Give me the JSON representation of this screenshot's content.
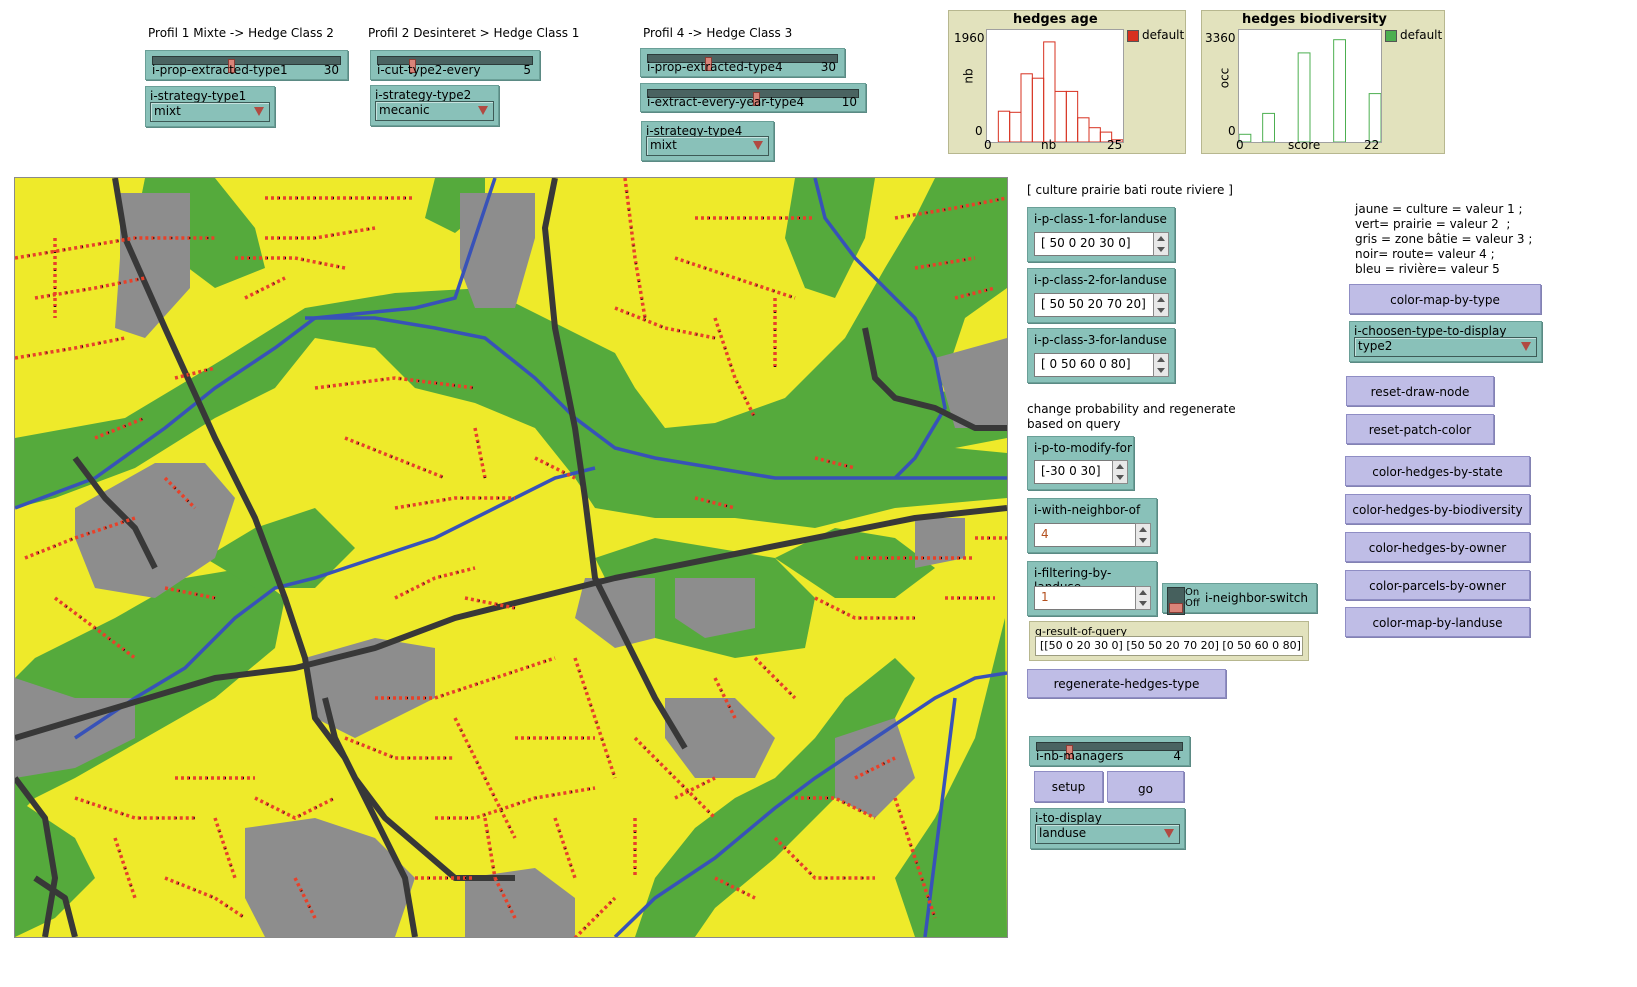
{
  "profiles": {
    "p1_title": "Profil 1 Mixte -> Hedge Class 2",
    "p2_title": "Profil 2 Desinteret > Hedge Class 1",
    "p4_title": "Profil 4 -> Hedge Class 3"
  },
  "sliders": {
    "prop1": {
      "label": "i-prop-extracted-type1",
      "value": "30",
      "fraction": 0.4
    },
    "cut2": {
      "label": "i-cut-type2-every",
      "value": "5",
      "fraction": 0.2
    },
    "prop4": {
      "label": "i-prop-extracted-type4",
      "value": "30",
      "fraction": 0.3
    },
    "extract4": {
      "label": "i-extract-every-year-type4",
      "value": "10",
      "fraction": 0.5
    },
    "managers": {
      "label": "i-nb-managers",
      "value": "4",
      "fraction": 0.2
    }
  },
  "choosers": {
    "strategy1": {
      "label": "i-strategy-type1",
      "value": "mixt"
    },
    "strategy2": {
      "label": "i-strategy-type2",
      "value": "mecanic"
    },
    "strategy4": {
      "label": "i-strategy-type4",
      "value": "mixt"
    },
    "display_type": {
      "label": "i-choosen-type-to-display",
      "value": "type2"
    },
    "to_display": {
      "label": "i-to-display",
      "value": "landuse"
    }
  },
  "plots": {
    "age": {
      "title": "hedges age",
      "ylabel": "nb",
      "xlabel": "nb",
      "ymin": "0",
      "ymax": "1960",
      "xmin": "0",
      "xmax": "25",
      "legend": "default",
      "color": "#d7301f"
    },
    "biodiv": {
      "title": "hedges biodiversity",
      "ylabel": "occ",
      "xlabel": "score",
      "ymin": "0",
      "ymax": "3360",
      "xmin": "0",
      "xmax": "22",
      "legend": "default",
      "color": "#4caf50"
    }
  },
  "landuse_header": "[ culture prairie bati route riviere ]",
  "inputs": {
    "class1": {
      "label": "i-p-class-1-for-landuse",
      "value": "[ 50 0 20 30 0]"
    },
    "class2": {
      "label": "i-p-class-2-for-landuse",
      "value": "[ 50 50 20 70 20]"
    },
    "class3": {
      "label": "i-p-class-3-for-landuse",
      "value": "[ 0 50 60 0 80]"
    },
    "modify": {
      "label": "i-p-to-modify-for",
      "value": "[-30 0 30]"
    },
    "neighbor": {
      "label": "i-with-neighbor-of",
      "value": "4"
    },
    "filtering": {
      "label": "i-filtering-by-landuse",
      "value": "1"
    }
  },
  "query_note": "change probability and regenerate\nbased on query",
  "switch": {
    "label": "i-neighbor-switch",
    "on": "On",
    "off": "Off"
  },
  "monitor": {
    "label": "g-result-of-query",
    "value": "[[50 0 20 30 0] [50 50 20 70 20] [0 50 60 0 80]]"
  },
  "buttons": {
    "regenerate": "regenerate-hedges-type",
    "color_map_type": "color-map-by-type",
    "reset_draw": "reset-draw-node",
    "reset_patch": "reset-patch-color",
    "by_state": "color-hedges-by-state",
    "by_biodiv": "color-hedges-by-biodiversity",
    "by_owner": "color-hedges-by-owner",
    "parcels_owner": "color-parcels-by-owner",
    "map_landuse": "color-map-by-landuse",
    "setup": "setup",
    "go": "go"
  },
  "legend_note": "jaune = culture = valeur 1 ;\nvert= prairie = valeur 2  ;\ngris = zone bâtie = valeur 3 ;\nnoir= route= valeur 4 ;\nbleu = rivière= valeur 5",
  "map_colors": {
    "culture": "#eeea2a",
    "prairie": "#55aa3c",
    "bati": "#8d8d8d",
    "route": "#383838",
    "riviere": "#3852b8",
    "hedge": "#e8412a",
    "hedge_dark": "#111111"
  }
}
